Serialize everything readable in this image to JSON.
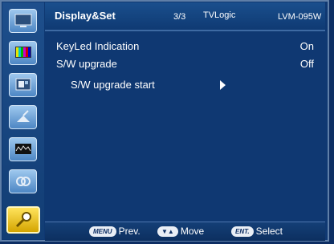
{
  "sidebar": {
    "items": [
      {
        "icon": "monitor-icon"
      },
      {
        "icon": "color-bars-icon"
      },
      {
        "icon": "display-layout-icon"
      },
      {
        "icon": "satellite-icon"
      },
      {
        "icon": "waveform-icon"
      },
      {
        "icon": "audio-link-icon"
      },
      {
        "icon": "tools-icon",
        "active": true
      }
    ]
  },
  "header": {
    "title": "Display&Set",
    "page": "3/3",
    "brand": "TVLogic",
    "model": "LVM-095W"
  },
  "menu": {
    "items": [
      {
        "label": "KeyLed Indication",
        "value": "On"
      },
      {
        "label": "S/W upgrade",
        "value": "Off"
      },
      {
        "label": "S/W upgrade start"
      }
    ]
  },
  "footer": {
    "prev_key": "MENU",
    "prev_label": "Prev.",
    "move_label": "Move",
    "select_key": "ENT.",
    "select_label": "Select"
  }
}
